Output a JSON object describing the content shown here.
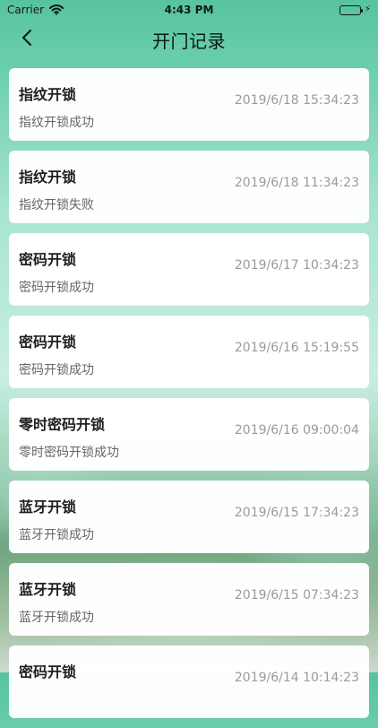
{
  "status_bar": {
    "carrier": "Carrier",
    "time": "4:43 PM"
  },
  "nav": {
    "title": "开门记录"
  },
  "records": [
    {
      "title": "指纹开锁",
      "status": "指纹开锁成功",
      "time": "2019/6/18 15:34:23"
    },
    {
      "title": "指纹开锁",
      "status": "指纹开锁失败",
      "time": "2019/6/18 11:34:23"
    },
    {
      "title": "密码开锁",
      "status": "密码开锁成功",
      "time": "2019/6/17 10:34:23"
    },
    {
      "title": "密码开锁",
      "status": "密码开锁成功",
      "time": "2019/6/16 15:19:55"
    },
    {
      "title": "零时密码开锁",
      "status": "零时密码开锁成功",
      "time": "2019/6/16 09:00:04"
    },
    {
      "title": "蓝牙开锁",
      "status": "蓝牙开锁成功",
      "time": "2019/6/15 17:34:23"
    },
    {
      "title": "蓝牙开锁",
      "status": "蓝牙开锁成功",
      "time": "2019/6/15 07:34:23"
    },
    {
      "title": "密码开锁",
      "status": "",
      "time": "2019/6/14 10:14:23"
    }
  ],
  "colors": {
    "accent_mint": "#6ccfae",
    "card_background": "#ffffff",
    "battery_green": "#2ecc71"
  },
  "icons": {
    "back": "chevron-left-icon",
    "wifi": "wifi-icon",
    "battery": "battery-icon",
    "charging": "charging-bolt-icon"
  }
}
